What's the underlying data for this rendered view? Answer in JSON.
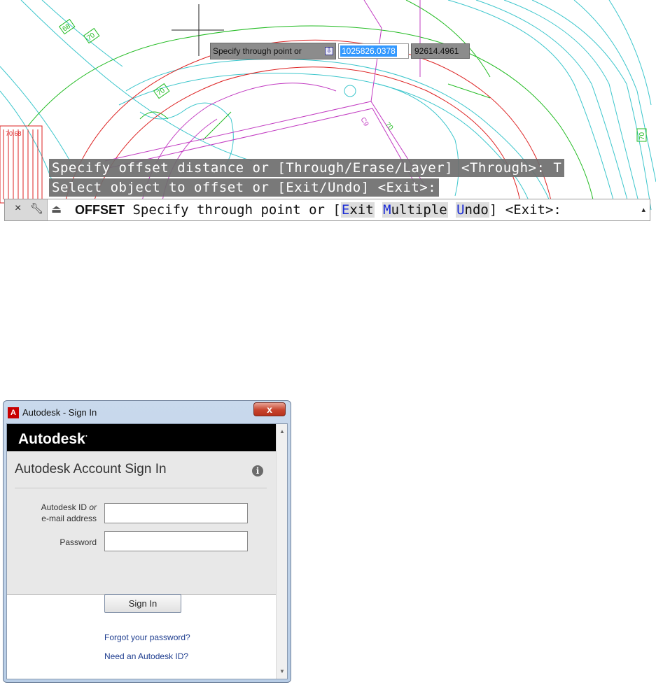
{
  "cad": {
    "history_lines": [
      "Specify offset distance or [Through/Erase/Layer] <Through>: T",
      "Select object to offset or [Exit/Undo] <Exit>:"
    ],
    "dynamic_input": {
      "prompt": "Specify through point or",
      "prompt_icon": "download-arrow-icon",
      "x_value": "1025826.0378",
      "y_value": "92614.4961"
    },
    "command_line": {
      "close_icon": "×",
      "settings_icon": "wrench-icon",
      "prompt_icon": "command-prompt-icon",
      "command_name": "OFFSET",
      "prompt_text": "Specify through point or [",
      "options": [
        {
          "key": "E",
          "rest": "xit"
        },
        {
          "key": "M",
          "rest": "ultiple"
        },
        {
          "key": "U",
          "rest": "ndo"
        }
      ],
      "suffix": "] <Exit>:",
      "scroll_arrow": "▴"
    },
    "drawing_labels": [
      "70",
      "68",
      "70",
      "70",
      "70",
      "C9",
      "70.68"
    ],
    "colors": {
      "contour_cyan": "#3cc6cc",
      "contour_green": "#22bb22",
      "boundary_red": "#dd2222",
      "road_magenta": "#c23cc2",
      "history_bg": "#6e6e6e",
      "option_key": "#1a2bd6"
    }
  },
  "dialog": {
    "title": "Autodesk - Sign In",
    "title_icon_letter": "A",
    "close_label": "x",
    "brand": "Autodesk",
    "brand_mark": "·",
    "heading": "Autodesk Account Sign In",
    "info_icon": "i",
    "id_label_line1": "Autodesk ID ",
    "id_label_or": "or",
    "id_label_line2": "e-mail address",
    "id_value": "",
    "password_label": "Password",
    "password_value": "",
    "sign_in_label": "Sign In",
    "forgot_link": "Forgot your password?",
    "need_id_link": "Need an Autodesk ID?",
    "colors": {
      "brand_bar": "#000000",
      "link": "#1e3d8f",
      "close_button": "#c7442d"
    }
  }
}
